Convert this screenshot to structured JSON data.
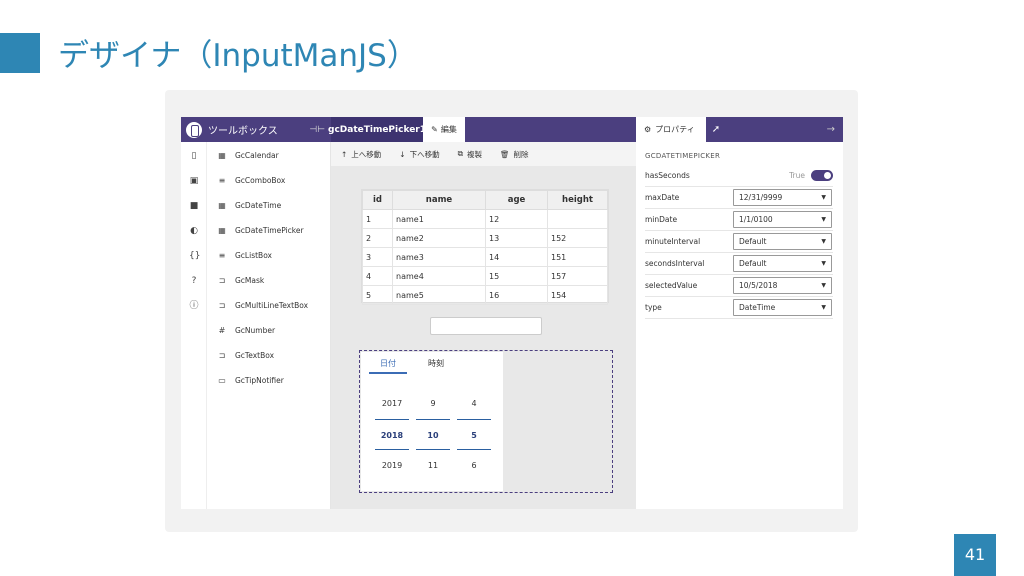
{
  "slide": {
    "title": "デザイナ（InputManJS）",
    "page_number": "41"
  },
  "topbar": {
    "toolbox_label": "ツールボックス",
    "active_tab": "gcDateTimePicker1",
    "edit_label": "編集",
    "props_label": "プロパティ"
  },
  "toolbox": {
    "items": [
      {
        "label": "GcCalendar",
        "icon": "calendar-icon"
      },
      {
        "label": "GcComboBox",
        "icon": "list-icon"
      },
      {
        "label": "GcDateTime",
        "icon": "calendar-icon"
      },
      {
        "label": "GcDateTimePicker",
        "icon": "calendar-icon"
      },
      {
        "label": "GcListBox",
        "icon": "list-icon"
      },
      {
        "label": "GcMask",
        "icon": "mask-icon"
      },
      {
        "label": "GcMultiLineTextBox",
        "icon": "textbox-icon"
      },
      {
        "label": "GcNumber",
        "icon": "number-icon"
      },
      {
        "label": "GcTextBox",
        "icon": "textbox-icon"
      },
      {
        "label": "GcTipNotifier",
        "icon": "tip-icon"
      }
    ]
  },
  "designer_toolbar": {
    "move_up": "上へ移動",
    "move_down": "下へ移動",
    "duplicate": "複製",
    "delete": "削除"
  },
  "grid": {
    "columns": [
      "id",
      "name",
      "age",
      "height"
    ],
    "rows": [
      [
        "1",
        "name1",
        "12",
        ""
      ],
      [
        "2",
        "name2",
        "13",
        "152"
      ],
      [
        "3",
        "name3",
        "14",
        "151"
      ],
      [
        "4",
        "name4",
        "15",
        "157"
      ],
      [
        "5",
        "name5",
        "16",
        "154"
      ]
    ]
  },
  "picker": {
    "tab_date": "日付",
    "tab_time": "時刻",
    "years": [
      "2017",
      "2018",
      "2019"
    ],
    "months": [
      "9",
      "10",
      "11"
    ],
    "days": [
      "4",
      "5",
      "6"
    ]
  },
  "properties": {
    "header": "GCDATETIMEPICKER",
    "has_seconds": {
      "label": "hasSeconds",
      "value": "True"
    },
    "max_date": {
      "label": "maxDate",
      "value": "12/31/9999"
    },
    "min_date": {
      "label": "minDate",
      "value": "1/1/0100"
    },
    "minute_interval": {
      "label": "minuteInterval",
      "value": "Default"
    },
    "seconds_interval": {
      "label": "secondsInterval",
      "value": "Default"
    },
    "selected_value": {
      "label": "selectedValue",
      "value": "10/5/2018"
    },
    "type": {
      "label": "type",
      "value": "DateTime"
    }
  },
  "colors": {
    "accent": "#2e86b4",
    "app_bar": "#4b3f7f"
  }
}
